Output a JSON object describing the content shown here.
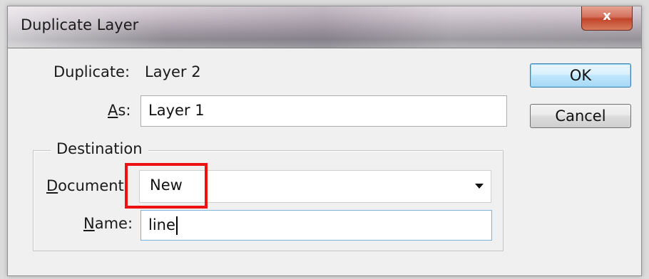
{
  "window": {
    "title": "Duplicate Layer",
    "close_label": "x"
  },
  "form": {
    "duplicate_label": "Duplicate:",
    "duplicate_value": "Layer 2",
    "as_label_accel": "A",
    "as_label_rest": "s:",
    "as_value": "Layer 1"
  },
  "destination": {
    "legend": "Destination",
    "document_label_accel": "D",
    "document_label_rest": "ocument:",
    "document_value": "New",
    "name_label_accel": "N",
    "name_label_rest": "ame:",
    "name_value": "line"
  },
  "buttons": {
    "ok": "OK",
    "cancel": "Cancel"
  },
  "colors": {
    "annotation_red": "#ee1111",
    "default_button_border": "#3c7fb1",
    "dialog_bg": "#f0f0f0"
  },
  "icons": {
    "close": "close-icon",
    "dropdown": "chevron-down-icon"
  }
}
